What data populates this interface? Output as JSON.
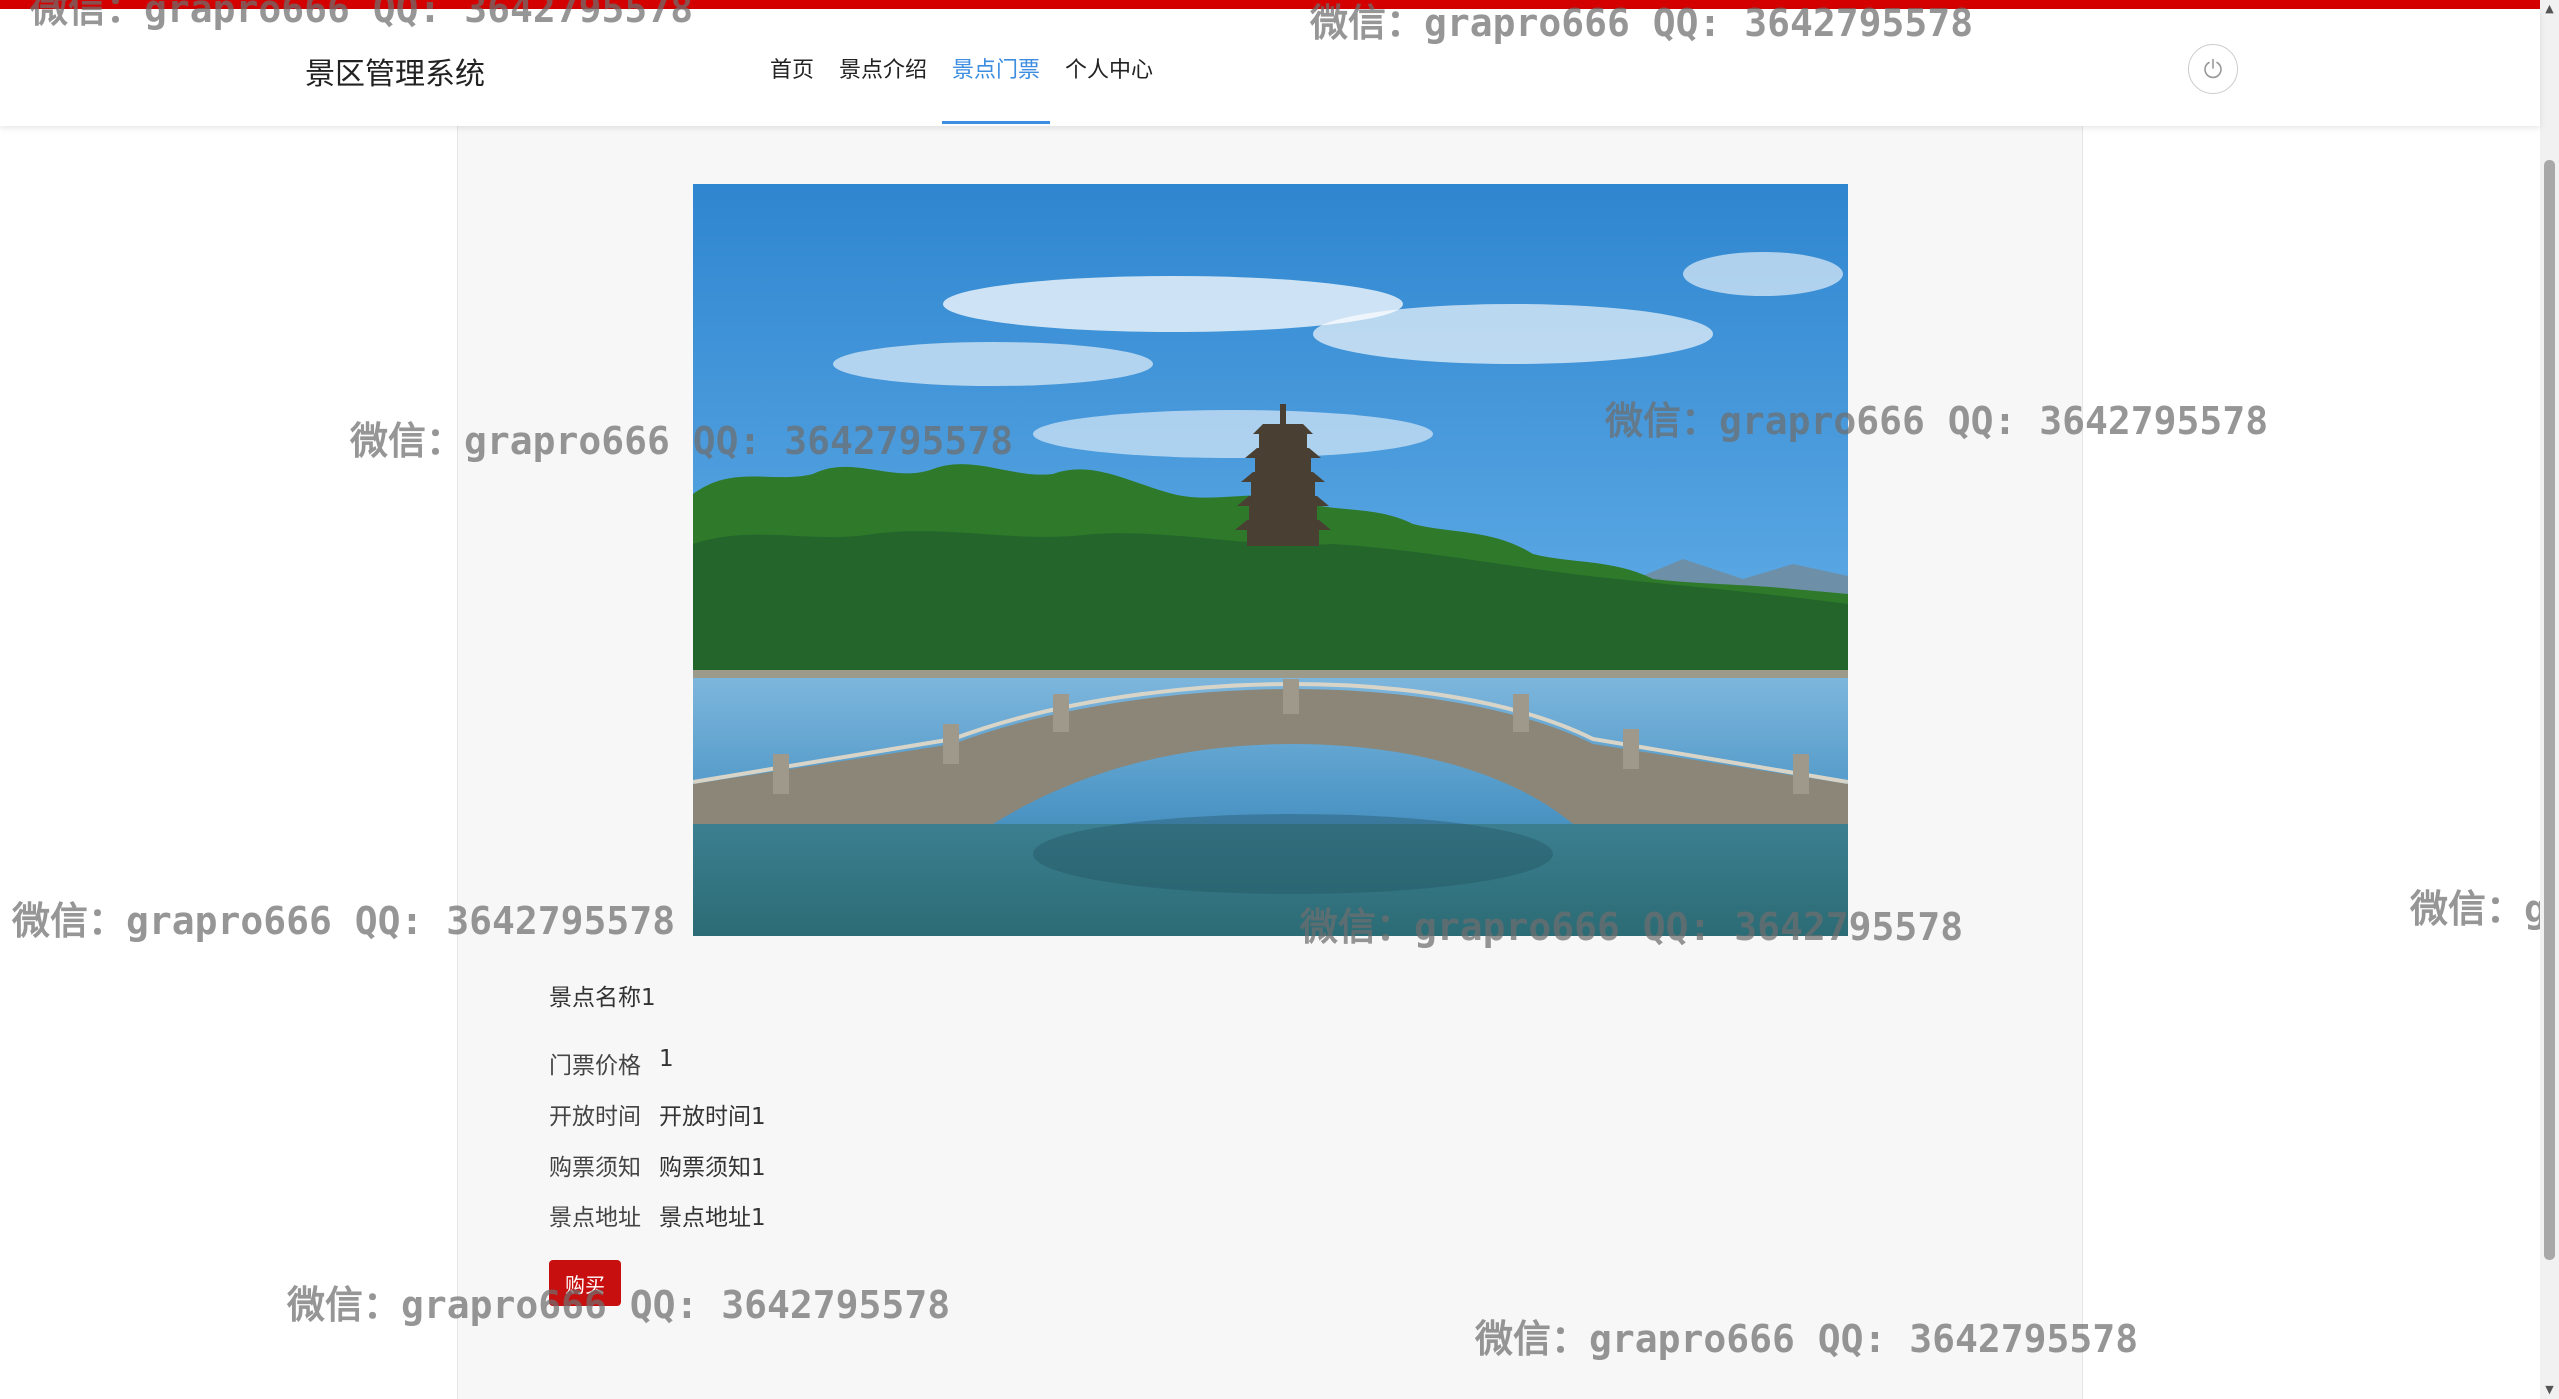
{
  "header": {
    "brand": "景区管理系统",
    "nav": [
      "首页",
      "景点介绍",
      "景点门票",
      "个人中心"
    ],
    "active_nav": "景点门票",
    "logout_icon": "power-icon"
  },
  "detail": {
    "name": "景点名称1",
    "fields": [
      {
        "label": "门票价格",
        "value": "1"
      },
      {
        "label": "开放时间",
        "value": "开放时间1"
      },
      {
        "label": "购票须知",
        "value": "购票须知1"
      },
      {
        "label": "景点地址",
        "value": "景点地址1"
      }
    ],
    "buy_label": "购买",
    "image_alt_icon": "scenic-photo"
  },
  "watermark": "微信：grapro666 QQ: 3642795578",
  "colors": {
    "accent": "#3d8ee0",
    "top_bar": "#d40000",
    "buy_button": "#c80f0f",
    "panel_bg": "#f7f7f7"
  }
}
